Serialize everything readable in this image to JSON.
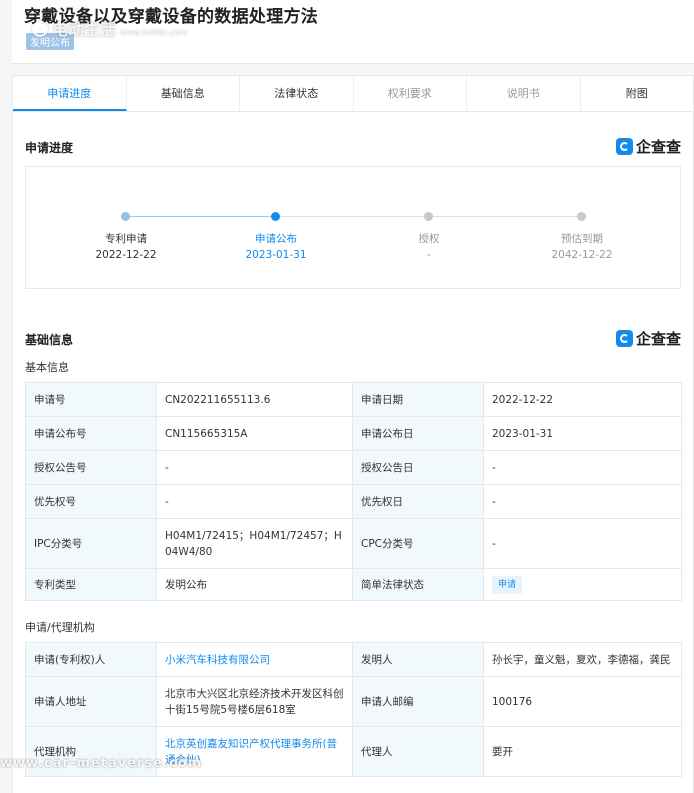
{
  "header": {
    "title": "穿戴设备以及穿戴设备的数据处理方法",
    "badge": "发明公布",
    "watermark_text": "电动生活",
    "watermark_url": "www.evlifes.com"
  },
  "tabs": [
    {
      "label": "申请进度",
      "state": "active"
    },
    {
      "label": "基础信息",
      "state": "normal"
    },
    {
      "label": "法律状态",
      "state": "normal"
    },
    {
      "label": "权利要求",
      "state": "disabled"
    },
    {
      "label": "说明书",
      "state": "disabled"
    },
    {
      "label": "附图",
      "state": "normal"
    }
  ],
  "logo": {
    "text": "企查查"
  },
  "progress": {
    "title": "申请进度",
    "steps": [
      {
        "label": "专利申请",
        "date": "2022-12-22",
        "color": "#333333"
      },
      {
        "label": "申请公布",
        "date": "2023-01-31",
        "color": "#128bed"
      },
      {
        "label": "授权",
        "date": "-",
        "color": "#999999"
      },
      {
        "label": "预估到期",
        "date": "2042-12-22",
        "color": "#999999"
      }
    ]
  },
  "basic": {
    "title": "基础信息",
    "subtitle": "基本信息",
    "rows": [
      {
        "k1": "申请号",
        "v1": "CN202211655113.6",
        "k2": "申请日期",
        "v2": "2022-12-22"
      },
      {
        "k1": "申请公布号",
        "v1": "CN115665315A",
        "k2": "申请公布日",
        "v2": "2023-01-31"
      },
      {
        "k1": "授权公告号",
        "v1": "-",
        "k2": "授权公告日",
        "v2": "-"
      },
      {
        "k1": "优先权号",
        "v1": "-",
        "k2": "优先权日",
        "v2": "-"
      },
      {
        "k1": "IPC分类号",
        "v1": "H04M1/72415；H04M1/72457；H04W4/80",
        "k2": "CPC分类号",
        "v2": "-"
      },
      {
        "k1": "专利类型",
        "v1": "发明公布",
        "k2": "简单法律状态",
        "v2": "申请"
      }
    ]
  },
  "agency": {
    "subtitle": "申请/代理机构",
    "rows": [
      {
        "k1": "申请(专利权)人",
        "v1": "小米汽车科技有限公司",
        "k2": "发明人",
        "v2": "孙长宇，童义魁，夏欢，李德福，龚民"
      },
      {
        "k1": "申请人地址",
        "v1": "北京市大兴区北京经济技术开发区科创十街15号院5号楼6层618室",
        "k2": "申请人邮编",
        "v2": "100176"
      },
      {
        "k1": "代理机构",
        "v1": "北京英创嘉友知识产权代理事务所(普通合伙)",
        "k2": "代理人",
        "v2": "要开"
      }
    ]
  },
  "bottom_watermark": "www.car-metaverse.com"
}
